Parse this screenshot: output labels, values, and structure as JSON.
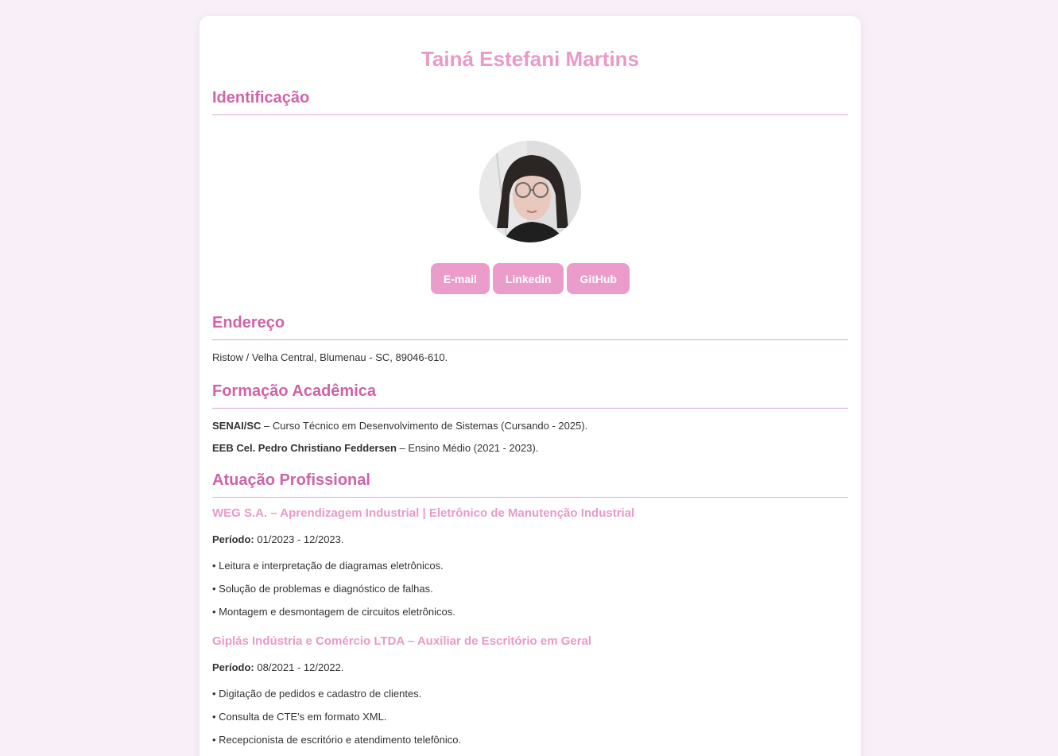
{
  "profile": {
    "name": "Tainá Estefani Martins"
  },
  "sections": {
    "identificacao": "Identificação",
    "endereco": "Endereço",
    "formacao": "Formação Acadêmica",
    "atuacao": "Atuação Profissional"
  },
  "links": {
    "email": "E-mail",
    "linkedin": "Linkedin",
    "github": "GitHub"
  },
  "address": "Ristow / Velha Central, Blumenau - SC, 89046-610.",
  "education": [
    {
      "institution": "SENAI/SC",
      "detail": " – Curso Técnico em Desenvolvimento de Sistemas (Cursando - 2025)."
    },
    {
      "institution": "EEB Cel. Pedro Christiano Feddersen",
      "detail": " – Ensino Médio (2021 - 2023)."
    }
  ],
  "jobs": [
    {
      "title": "WEG S.A. – Aprendizagem Industrial | Eletrônico de Manutenção Industrial",
      "period_label": "Período:",
      "period": " 01/2023 - 12/2023.",
      "tasks": [
        "• Leitura e interpretação de diagramas eletrônicos.",
        "• Solução de problemas e diagnóstico de falhas.",
        "• Montagem e desmontagem de circuitos eletrônicos."
      ]
    },
    {
      "title": "Giplás Indústria e Comércio LTDA – Auxiliar de Escritório em Geral",
      "period_label": "Período:",
      "period": " 08/2021 - 12/2022.",
      "tasks": [
        "• Digitação de pedidos e cadastro de clientes.",
        "• Consulta de CTE's em formato XML.",
        "• Recepcionista de escritório e atendimento telefônico."
      ]
    }
  ],
  "colors": {
    "background": "#f8eff8",
    "accent": "#e99ac8",
    "section_title": "#d063a8",
    "button": "#eb9ccb",
    "divider": "#dca7cd"
  }
}
